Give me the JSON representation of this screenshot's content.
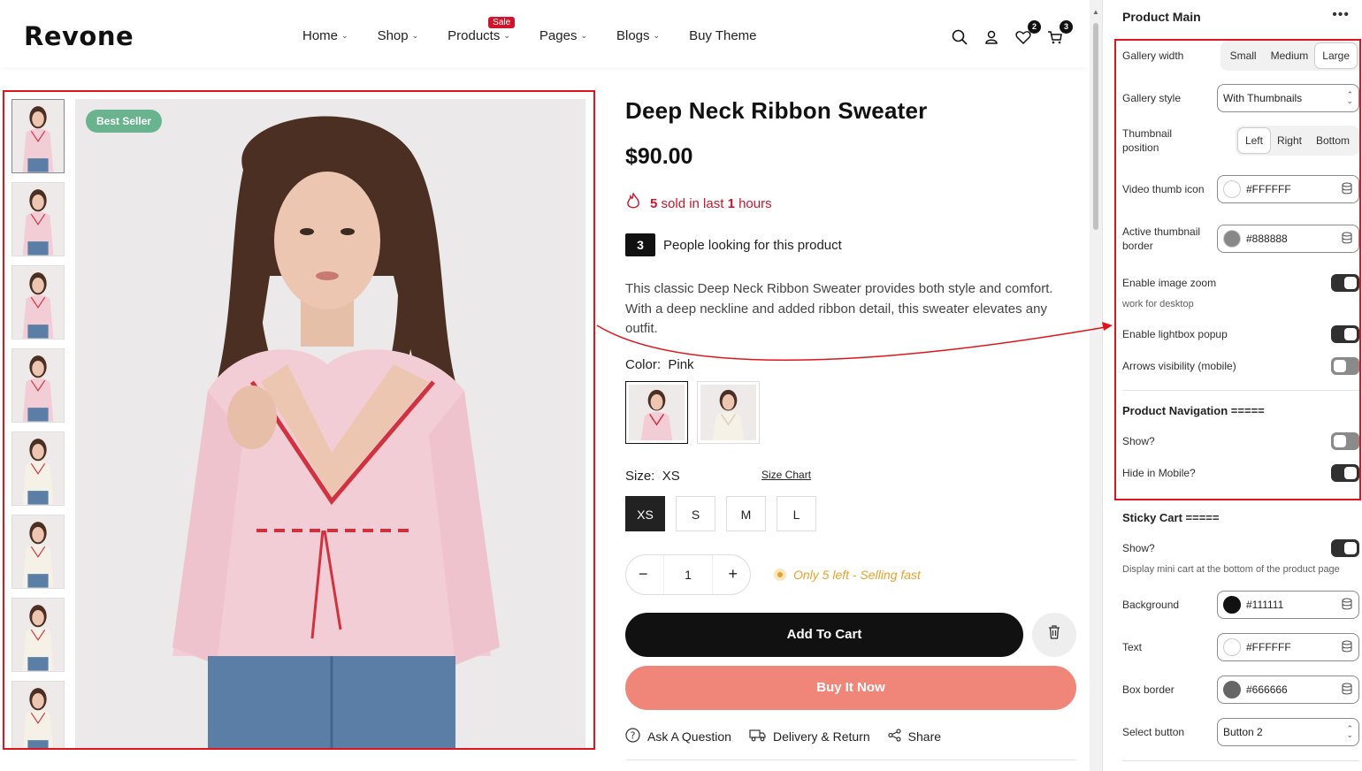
{
  "brand": {
    "logo": "Revone"
  },
  "nav": {
    "items": [
      {
        "label": "Home",
        "dropdown": true
      },
      {
        "label": "Shop",
        "dropdown": true
      },
      {
        "label": "Products",
        "dropdown": true,
        "badge": "Sale"
      },
      {
        "label": "Pages",
        "dropdown": true
      },
      {
        "label": "Blogs",
        "dropdown": true
      },
      {
        "label": "Buy Theme",
        "dropdown": false
      }
    ],
    "icons": [
      "search-icon",
      "user-icon",
      "heart-icon",
      "cart-icon"
    ],
    "wishlist_count": "2",
    "cart_count": "3"
  },
  "product": {
    "badge": "Best Seller",
    "title": "Deep Neck Ribbon Sweater",
    "price": "$90.00",
    "sold_count": "5",
    "sold_text_mid": "sold in last",
    "sold_hours": "1",
    "sold_text_end": "hours",
    "looking_count": "3",
    "looking_text": "People looking for this product",
    "description": "This classic Deep Neck Ribbon Sweater provides both style and comfort. With a deep neckline and added ribbon detail, this sweater elevates any outfit.",
    "color_label": "Color:",
    "color_value": "Pink",
    "size_label": "Size:",
    "size_value": "XS",
    "size_chart": "Size Chart",
    "sizes": [
      "XS",
      "S",
      "M",
      "L"
    ],
    "quantity": "1",
    "qty_minus": "−",
    "qty_plus": "+",
    "stock_text": "Only 5 left - Selling fast",
    "add_to_cart": "Add To Cart",
    "buy_now": "Buy It Now",
    "links": [
      "Ask A Question",
      "Delivery & Return",
      "Share"
    ],
    "thumbnail_count": 8
  },
  "panel": {
    "title": "Product Main",
    "menu": "•••",
    "gallery_width_label": "Gallery width",
    "gallery_width_options": [
      "Small",
      "Medium",
      "Large"
    ],
    "gallery_width_selected": "Large",
    "gallery_style_label": "Gallery style",
    "gallery_style_value": "With Thumbnails",
    "thumb_position_label": "Thumbnail position",
    "thumb_position_options": [
      "Left",
      "Right",
      "Bottom"
    ],
    "thumb_position_selected": "Left",
    "video_thumb_label": "Video thumb icon",
    "video_thumb_color": "#FFFFFF",
    "active_border_label": "Active thumbnail border",
    "active_border_color": "#888888",
    "zoom_label": "Enable image zoom",
    "zoom_on": true,
    "zoom_hint": "work for desktop",
    "lightbox_label": "Enable lightbox popup",
    "lightbox_on": true,
    "arrows_label": "Arrows visibility (mobile)",
    "arrows_on": false,
    "nav_section": "Product Navigation =====",
    "nav_show_label": "Show?",
    "nav_show_on": false,
    "nav_hide_mobile_label": "Hide in Mobile?",
    "nav_hide_mobile_on": true,
    "sticky_section": "Sticky Cart =====",
    "sticky_show_label": "Show?",
    "sticky_show_on": true,
    "sticky_hint": "Display mini cart at the bottom of the product page",
    "bg_label": "Background",
    "bg_color": "#111111",
    "text_label": "Text",
    "text_color": "#FFFFFF",
    "box_border_label": "Box border",
    "box_border_color": "#666666",
    "select_button_label": "Select button",
    "select_button_value": "Button 2"
  },
  "colors": {
    "accent_red": "#d0142c",
    "highlight_border": "#e0141c",
    "best_seller": "#6ab38f",
    "buy_now": "#f0867a",
    "stock": "#e8a12a"
  }
}
